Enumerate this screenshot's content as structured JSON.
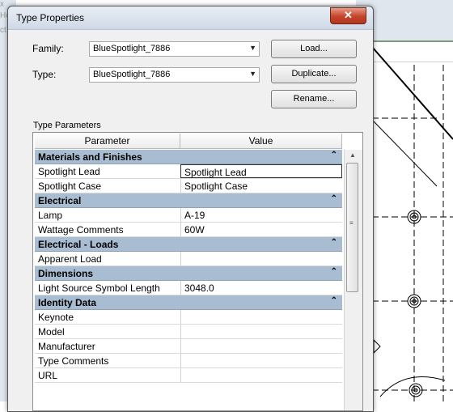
{
  "background": {
    "left_text": [
      "x",
      "Ho",
      "ct"
    ]
  },
  "dialog": {
    "title": "Type Properties",
    "close_glyph": "✕",
    "family_label": "Family:",
    "family_value": "BlueSpotlight_7886",
    "type_label": "Type:",
    "type_value": "BlueSpotlight_7886",
    "load_button": "Load...",
    "duplicate_button": "Duplicate...",
    "rename_button": "Rename...",
    "type_parameters_label": "Type Parameters",
    "columns": {
      "parameter": "Parameter",
      "value": "Value"
    },
    "groups": [
      {
        "name": "Materials and Finishes",
        "rows": [
          {
            "param": "Spotlight Lead",
            "value": "Spotlight Lead"
          },
          {
            "param": "Spotlight Case",
            "value": "Spotlight Case"
          }
        ]
      },
      {
        "name": "Electrical",
        "rows": [
          {
            "param": "Lamp",
            "value": "A-19"
          },
          {
            "param": "Wattage Comments",
            "value": "60W"
          }
        ]
      },
      {
        "name": "Electrical - Loads",
        "rows": [
          {
            "param": "Apparent Load",
            "value": ""
          }
        ]
      },
      {
        "name": "Dimensions",
        "rows": [
          {
            "param": "Light Source Symbol Length",
            "value": "3048.0"
          }
        ]
      },
      {
        "name": "Identity Data",
        "rows": [
          {
            "param": "Keynote",
            "value": ""
          },
          {
            "param": "Model",
            "value": ""
          },
          {
            "param": "Manufacturer",
            "value": ""
          },
          {
            "param": "Type Comments",
            "value": ""
          },
          {
            "param": "URL",
            "value": ""
          }
        ]
      }
    ],
    "colors": {
      "group_header": "#a9bdd2",
      "close_button": "#c6432a"
    }
  }
}
